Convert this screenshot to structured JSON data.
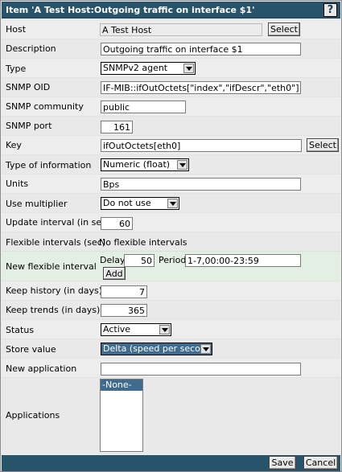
{
  "dialog": {
    "title": "Item 'A Test Host:Outgoing traffic on interface $1'",
    "help_label": "?"
  },
  "fields": {
    "host": {
      "label": "Host",
      "value": "A Test Host",
      "button": "Select"
    },
    "description": {
      "label": "Description",
      "value": "Outgoing traffic on interface $1"
    },
    "type": {
      "label": "Type",
      "value": "SNMPv2 agent"
    },
    "snmp_oid": {
      "label": "SNMP OID",
      "value": "IF-MIB::ifOutOctets[\"index\",\"ifDescr\",\"eth0\"]"
    },
    "snmp_community": {
      "label": "SNMP community",
      "value": "public"
    },
    "snmp_port": {
      "label": "SNMP port",
      "value": "161"
    },
    "key": {
      "label": "Key",
      "value": "ifOutOctets[eth0]",
      "button": "Select"
    },
    "type_of_information": {
      "label": "Type of information",
      "value": "Numeric (float)"
    },
    "units": {
      "label": "Units",
      "value": "Bps"
    },
    "use_multiplier": {
      "label": "Use multiplier",
      "value": "Do not use"
    },
    "update_interval": {
      "label": "Update interval (in sec)",
      "value": "60"
    },
    "flexible_intervals": {
      "label": "Flexible intervals (sec)",
      "value": "No flexible intervals"
    },
    "new_flexible_interval": {
      "label": "New flexible interval",
      "delay_label": "Delay",
      "delay_value": "50",
      "period_label": "Period",
      "period_value": "1-7,00:00-23:59",
      "add_button": "Add"
    },
    "keep_history": {
      "label": "Keep history (in days)",
      "value": "7"
    },
    "keep_trends": {
      "label": "Keep trends (in days)",
      "value": "365"
    },
    "status": {
      "label": "Status",
      "value": "Active"
    },
    "store_value": {
      "label": "Store value",
      "value": "Delta (speed per second)"
    },
    "new_application": {
      "label": "New application",
      "value": ""
    },
    "applications": {
      "label": "Applications",
      "options": [
        "-None-"
      ],
      "selected": "-None-"
    }
  },
  "footer": {
    "save_label": "Save",
    "cancel_label": "Cancel"
  },
  "colors": {
    "titlebar": "#27536b",
    "selected_option": "#3e6b8e",
    "highlight_row": "#e3efe3"
  }
}
